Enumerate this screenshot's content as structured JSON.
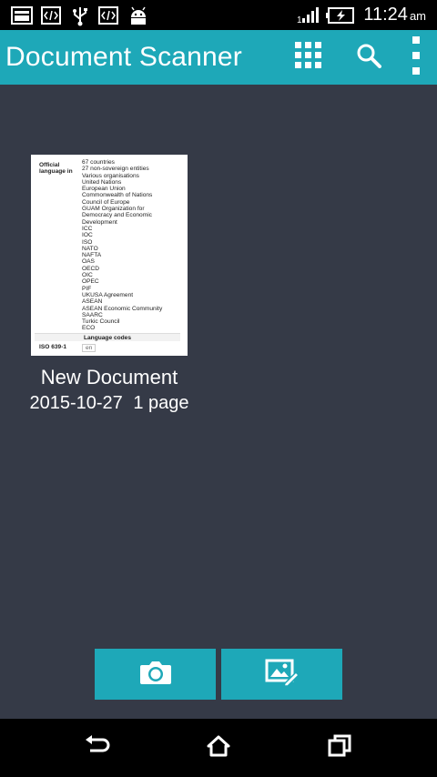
{
  "status_bar": {
    "time": "11:24",
    "ampm": "am",
    "icons": [
      "gallery-notification-icon",
      "code-notification-icon",
      "usb-icon",
      "code-notification-icon",
      "android-icon",
      "signal-icon",
      "battery-charging-icon"
    ],
    "signal_label": "1"
  },
  "app_bar": {
    "title": "Document Scanner",
    "actions": [
      "grid-view-icon",
      "search-icon",
      "overflow-menu-icon"
    ]
  },
  "documents": [
    {
      "name": "New Document",
      "date": "2015-10-27",
      "pages": "1 page",
      "thumbnail": {
        "label": "Official language in",
        "lines": [
          "67 countries",
          "27 non-sovereign entities",
          "Various organisations",
          "United Nations",
          "European Union",
          "Commonwealth of Nations",
          "Council of Europe",
          "GUAM Organization for",
          "Democracy and Economic",
          "Development",
          "ICC",
          "IOC",
          "ISO",
          "NATO",
          "NAFTA",
          "OAS",
          "OECD",
          "OIC",
          "OPEC",
          "PIF",
          "UKUSA Agreement",
          "ASEAN",
          "ASEAN Economic Community",
          "SAARC",
          "Turkic Council",
          "ECO"
        ],
        "section": "Language codes",
        "code_label": "ISO 639-1",
        "code_value": "en"
      }
    }
  ],
  "actions": {
    "camera": "camera-icon",
    "gallery": "gallery-edit-icon"
  },
  "nav_bar": [
    "back-icon",
    "home-icon",
    "recents-icon"
  ],
  "colors": {
    "accent": "#1ea8b8",
    "background": "#353a47",
    "bars": "#000000"
  }
}
